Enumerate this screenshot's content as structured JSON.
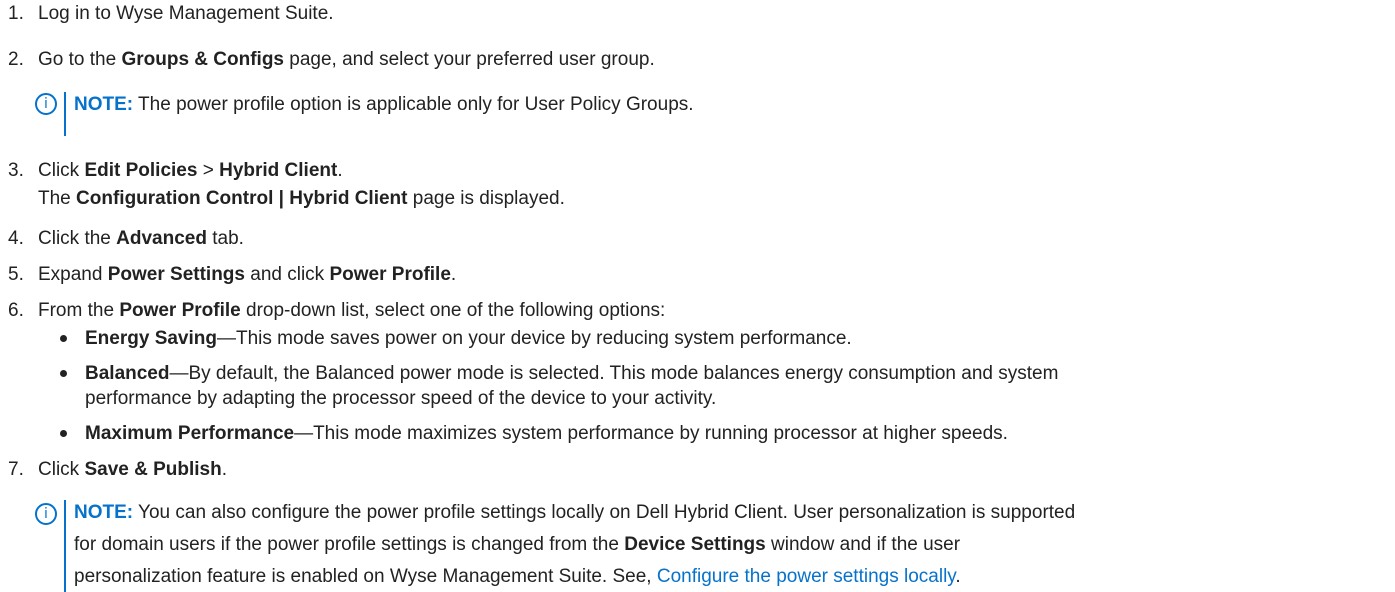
{
  "steps": [
    {
      "num": "1.",
      "text": "Log in to Wyse Management Suite."
    },
    {
      "num": "2.",
      "pre": "Go to the ",
      "bold": "Groups & Configs",
      "post": " page, and select your preferred user group."
    },
    {
      "num": "3.",
      "pre": "Click ",
      "bold1": "Edit Policies",
      "mid": " > ",
      "bold2": "Hybrid Client",
      "post": ".",
      "line2_pre": "The ",
      "line2_bold": "Configuration Control | Hybrid Client",
      "line2_post": " page is displayed."
    },
    {
      "num": "4.",
      "pre": "Click the ",
      "bold": "Advanced",
      "post": " tab."
    },
    {
      "num": "5.",
      "pre": "Expand ",
      "bold1": "Power Settings",
      "mid": " and click ",
      "bold2": "Power Profile",
      "post": "."
    },
    {
      "num": "6.",
      "pre": "From the ",
      "bold": "Power Profile",
      "post": " drop-down list, select one of the following options:"
    },
    {
      "num": "7.",
      "pre": "Click ",
      "bold": "Save & Publish",
      "post": "."
    }
  ],
  "note1": {
    "icon": "i",
    "label": "NOTE:",
    "text": " The power profile option is applicable only for User Policy Groups."
  },
  "options": [
    {
      "bold": "Energy Saving",
      "text": "—This mode saves power on your device by reducing system performance."
    },
    {
      "bold": "Balanced",
      "text": "—By default, the Balanced power mode is selected. This mode balances energy consumption and system",
      "text2": "performance by adapting the processor speed of the device to your activity."
    },
    {
      "bold": "Maximum Performance",
      "text": "—This mode maximizes system performance by running processor at higher speeds."
    }
  ],
  "note2": {
    "icon": "i",
    "label": "NOTE:",
    "line1": " You can also configure the power profile settings locally on Dell Hybrid Client. User personalization is supported",
    "line2_pre": "for domain users if the power profile settings is changed from the ",
    "line2_bold": "Device Settings",
    "line2_post": " window and if the user",
    "line3_pre": "personalization feature is enabled on Wyse Management Suite. See, ",
    "link": "Configure the power settings locally",
    "line3_post": "."
  },
  "colors": {
    "note_accent": "#0672CB",
    "text": "#222222"
  }
}
